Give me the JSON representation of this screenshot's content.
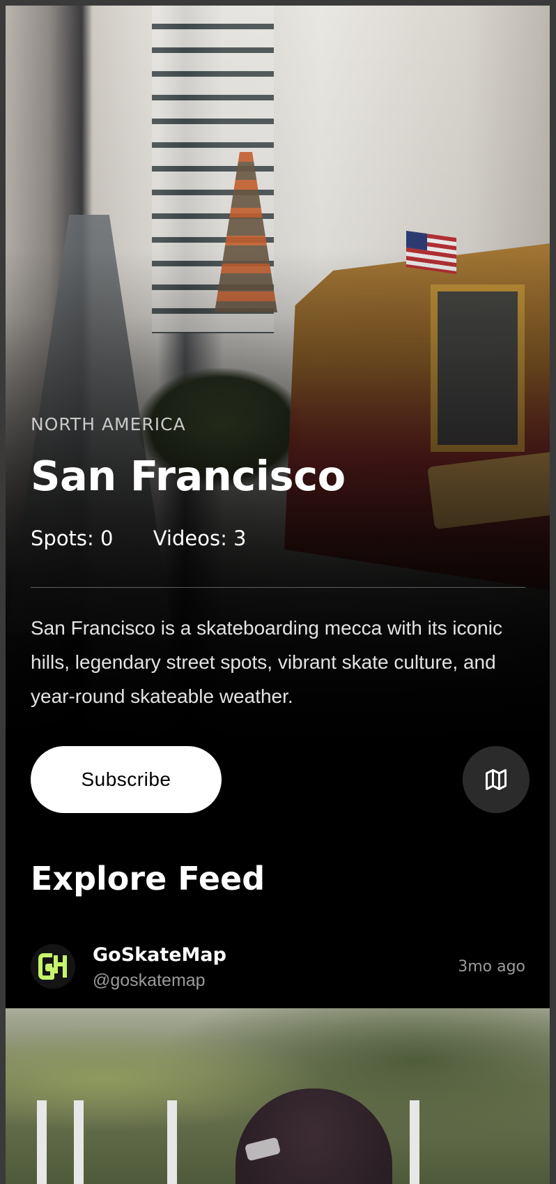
{
  "hero": {
    "region": "NORTH AMERICA",
    "title": "San Francisco",
    "stats": {
      "spots": "Spots: 0",
      "videos": "Videos: 3"
    },
    "description": "San Francisco is a skateboarding mecca with its iconic hills, legendary street spots, vibrant skate culture, and year-round skateable weather.",
    "subscribe_label": "Subscribe",
    "map_icon": "map-icon"
  },
  "feed": {
    "title": "Explore Feed",
    "post": {
      "author_name": "GoSkateMap",
      "author_handle": "@goskatemap",
      "time": "3mo ago",
      "avatar_icon": "goskatemap-logo",
      "avatar_color": "#c6f36b"
    }
  }
}
